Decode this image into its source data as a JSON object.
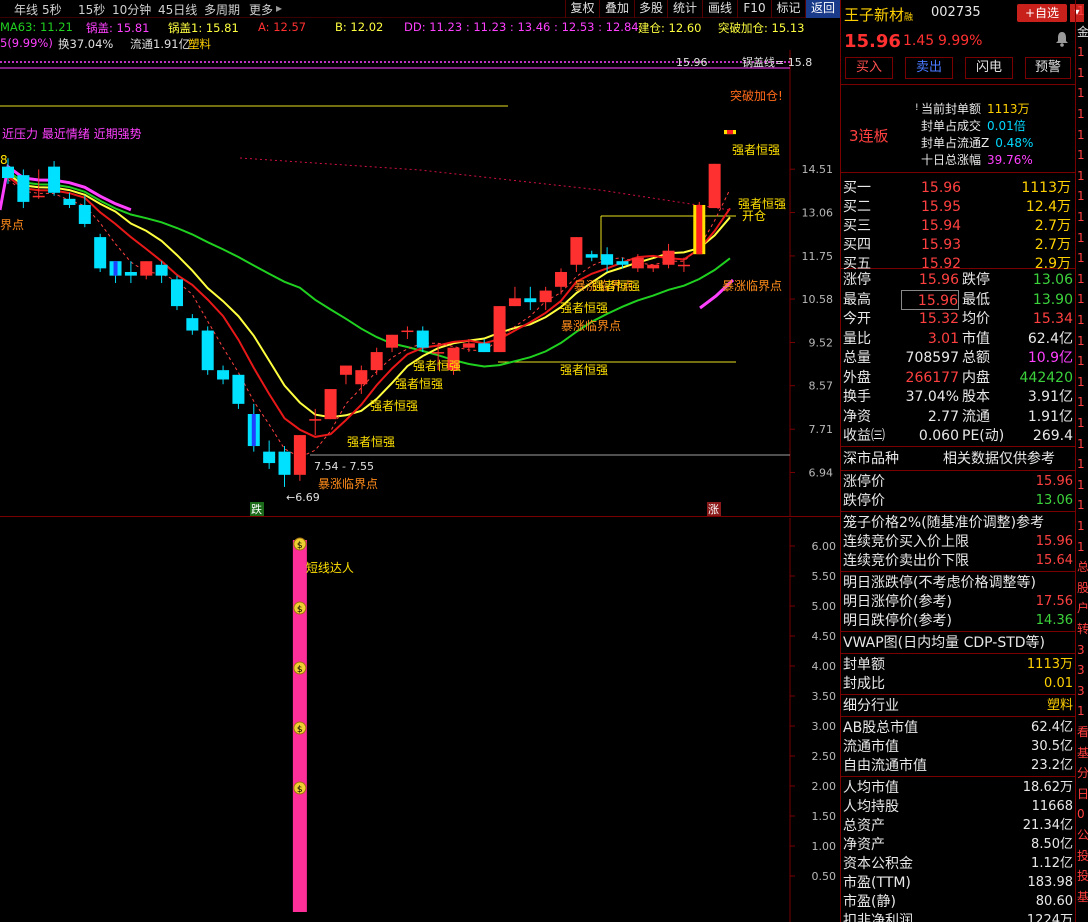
{
  "toolbar": {
    "items": [
      "年线",
      "5秒",
      "15秒",
      "10分钟",
      "45日线",
      "多周期",
      "更多"
    ],
    "more_arrow": "▸",
    "buttons": [
      "复权",
      "叠加",
      "多股",
      "统计",
      "画线",
      "F10",
      "标记",
      "返回"
    ]
  },
  "info1": {
    "ma63": "MA63: 11.21",
    "guogai": "锅盖: 15.81",
    "guogai1": "锅盖1: 15.81",
    "a": "A: 12.57",
    "b": "B: 12.02",
    "dd": "DD: 11.23 : 11.23 : 13.46 : 12.53 : 12.84",
    "jiancang": "建仓: 12.60",
    "tupo": "突破加仓: 15.13"
  },
  "info2": {
    "pct": "5(9.99%)",
    "turnover": "换37.04%",
    "float": "流通1.91亿",
    "industry": "塑料"
  },
  "chart_data": {
    "type": "candlestick",
    "price_axis": [
      "14.51",
      "13.06",
      "11.75",
      "10.58",
      "9.52",
      "8.57",
      "7.71",
      "6.94"
    ],
    "price_axis_values": [
      14.51,
      13.06,
      11.75,
      10.58,
      9.52,
      8.57,
      7.71,
      6.94
    ],
    "indicator_axis": [
      "6.00",
      "5.50",
      "5.00",
      "4.50",
      "4.00",
      "3.50",
      "3.00",
      "2.50",
      "2.00",
      "1.50",
      "1.00",
      "0.50"
    ],
    "indicator_axis_values": [
      6,
      5.5,
      5,
      4.5,
      4,
      3.5,
      3,
      2.5,
      2,
      1.5,
      1,
      0.5
    ],
    "candles": [
      [
        14.6,
        14.9,
        14.2,
        14.0
      ],
      [
        14.3,
        14.5,
        13.4,
        13.2
      ],
      [
        13.6,
        14.5,
        13.6,
        13.5
      ],
      [
        14.6,
        14.8,
        13.7,
        13.6
      ],
      [
        13.5,
        13.7,
        13.3,
        13.2
      ],
      [
        13.3,
        13.6,
        12.7,
        12.6
      ],
      [
        12.3,
        12.4,
        11.4,
        11.3
      ],
      [
        11.6,
        11.6,
        11.2,
        11.0
      ],
      [
        11.3,
        11.6,
        11.2,
        11.0
      ],
      [
        11.2,
        11.6,
        11.6,
        11.1
      ],
      [
        11.5,
        11.6,
        11.2,
        11.0
      ],
      [
        11.1,
        11.2,
        10.4,
        10.3
      ],
      [
        10.1,
        10.2,
        9.8,
        9.7
      ],
      [
        9.8,
        9.9,
        8.9,
        8.8
      ],
      [
        8.9,
        9.0,
        8.7,
        8.6
      ],
      [
        8.8,
        8.8,
        8.2,
        8.1
      ],
      [
        8.0,
        8.2,
        7.4,
        7.3
      ],
      [
        7.3,
        7.5,
        7.1,
        7.0
      ],
      [
        7.3,
        7.4,
        6.9,
        6.7
      ],
      [
        6.9,
        7.6,
        7.6,
        6.8
      ],
      [
        7.9,
        8.1,
        7.9,
        7.6
      ],
      [
        7.9,
        8.5,
        8.5,
        7.9
      ],
      [
        8.8,
        9.0,
        9.0,
        8.6
      ],
      [
        8.6,
        9.0,
        8.9,
        8.4
      ],
      [
        8.9,
        9.4,
        9.3,
        8.8
      ],
      [
        9.4,
        9.7,
        9.7,
        9.3
      ],
      [
        9.8,
        9.9,
        9.8,
        9.6
      ],
      [
        9.8,
        9.9,
        9.4,
        9.3
      ],
      [
        9.3,
        9.5,
        9.3,
        8.9
      ],
      [
        8.9,
        9.4,
        9.4,
        8.8
      ],
      [
        9.4,
        9.6,
        9.5,
        9.3
      ],
      [
        9.5,
        9.6,
        9.3,
        9.3
      ],
      [
        9.3,
        10.4,
        10.4,
        9.3
      ],
      [
        10.4,
        10.9,
        10.6,
        10.4
      ],
      [
        10.6,
        10.9,
        10.5,
        10.3
      ],
      [
        10.5,
        10.9,
        10.8,
        10.3
      ],
      [
        10.9,
        11.4,
        11.3,
        10.7
      ],
      [
        11.5,
        12.3,
        12.3,
        11.3
      ],
      [
        11.8,
        11.9,
        11.7,
        11.6
      ],
      [
        11.8,
        12.0,
        11.5,
        11.3
      ],
      [
        11.6,
        11.7,
        11.5,
        11.4
      ],
      [
        11.4,
        11.8,
        11.7,
        11.3
      ],
      [
        11.4,
        11.5,
        11.5,
        11.3
      ],
      [
        11.5,
        12.1,
        11.9,
        11.4
      ],
      [
        11.5,
        11.7,
        11.5,
        11.3
      ],
      [
        11.8,
        13.4,
        13.3,
        11.8
      ],
      [
        13.2,
        14.7,
        14.7,
        13.2
      ],
      [
        15.8,
        15.96,
        15.96,
        15.8
      ]
    ],
    "annotations": [
      {
        "text": "强者恒强",
        "type": "label"
      },
      {
        "text": "暴涨临界点",
        "type": "label"
      },
      {
        "text": "强者恒强",
        "type": "label"
      },
      {
        "text": "强者恒强",
        "type": "label"
      },
      {
        "text": "暴涨临界点",
        "type": "label"
      },
      {
        "text": "强者恒强",
        "type": "label"
      },
      {
        "text": "强者恒强",
        "type": "label"
      },
      {
        "text": "暴涨临界点",
        "type": "label"
      },
      {
        "text": "强者恒强",
        "type": "label"
      },
      {
        "text": "开仓",
        "type": "label"
      },
      {
        "text": "突破加仓!",
        "type": "label"
      },
      {
        "text": "强者恒强",
        "type": "label"
      },
      {
        "text": "强者恒强",
        "type": "label"
      },
      {
        "text": "强者恒强",
        "type": "label"
      }
    ],
    "top_left_text": "近压力 最近情绪 近期强势",
    "left_label": "界点",
    "left_label2": "8",
    "low_label": "6.69",
    "range_label": "7.54 - 7.55",
    "high_label": "15.96",
    "guogai_label": "锅盖线= 15.8",
    "die_badge": "跌",
    "zhang_badge": "涨",
    "indicator_label": "短线达人",
    "indicator_icon": "money-bag-icon",
    "indicator_icon_glyph": "$",
    "bar_value": 6.0,
    "colors": {
      "up": "#ff3030",
      "down": "#00e0ff",
      "ma_yellow": "#ffff40",
      "ma_red": "#ff2020",
      "ma_green": "#20d020",
      "ma_magenta": "#ff40ff",
      "limit_up": "#ffe000"
    }
  },
  "stock": {
    "name": "王子新材",
    "tag": "融",
    "code": "002735",
    "add_btn": "+自选",
    "price": "15.96",
    "change": "1.45",
    "change_pct": "9.99%",
    "bell_icon": "bell-icon"
  },
  "trade_buttons": [
    "买入",
    "卖出",
    "闪电",
    "预警"
  ],
  "lianban": {
    "label": "3连板",
    "rows": [
      {
        "k": "当前封单额",
        "v": "1113万",
        "icon": "!"
      },
      {
        "k": "封单占成交",
        "v": "0.01倍"
      },
      {
        "k": "封单占流通Z",
        "v": "0.48%"
      },
      {
        "k": "十日总涨幅",
        "v": "39.76%"
      }
    ]
  },
  "bids": [
    {
      "k": "买一",
      "p": "15.96",
      "v": "1113万"
    },
    {
      "k": "买二",
      "p": "15.95",
      "v": "12.4万"
    },
    {
      "k": "买三",
      "p": "15.94",
      "v": "2.7万"
    },
    {
      "k": "买四",
      "p": "15.93",
      "v": "2.7万"
    },
    {
      "k": "买五",
      "p": "15.92",
      "v": "2.9万"
    }
  ],
  "stats": [
    {
      "k1": "涨停",
      "v1": "15.96",
      "c1": "red",
      "k2": "跌停",
      "v2": "13.06",
      "c2": "green"
    },
    {
      "k1": "最高",
      "v1": "15.96",
      "c1": "red",
      "k2": "最低",
      "v2": "13.90",
      "c2": "green"
    },
    {
      "k1": "今开",
      "v1": "15.32",
      "c1": "red",
      "k2": "均价",
      "v2": "15.34",
      "c2": "red"
    },
    {
      "k1": "量比",
      "v1": "3.01",
      "c1": "red",
      "k2": "市值",
      "v2": "62.4亿",
      "c2": "white"
    },
    {
      "k1": "总量",
      "v1": "708597",
      "c1": "white",
      "k2": "总额",
      "v2": "10.9亿",
      "c2": "magenta"
    },
    {
      "k1": "外盘",
      "v1": "266177",
      "c1": "red",
      "k2": "内盘",
      "v2": "442420",
      "c2": "green"
    },
    {
      "k1": "换手",
      "v1": "37.04%",
      "c1": "white",
      "k2": "股本",
      "v2": "3.91亿",
      "c2": "white"
    },
    {
      "k1": "净资",
      "v1": "2.77",
      "c1": "white",
      "k2": "流通",
      "v2": "1.91亿",
      "c2": "white"
    },
    {
      "k1": "收益㈢",
      "v1": "0.060",
      "c1": "white",
      "k2": "PE(动)",
      "v2": "269.4",
      "c2": "white"
    }
  ],
  "market": {
    "left": "深市品种",
    "right": "相关数据仅供参考"
  },
  "limits": [
    {
      "k": "涨停价",
      "v": "15.96",
      "c": "red"
    },
    {
      "k": "跌停价",
      "v": "13.06",
      "c": "green"
    }
  ],
  "cage_title": "笼子价格2%(随基准价调整)参考",
  "auction": [
    {
      "k": "连续竞价买入价上限",
      "v": "15.96",
      "c": "red"
    },
    {
      "k": "连续竞价卖出价下限",
      "v": "15.64",
      "c": "red"
    }
  ],
  "tomorrow_title": "明日涨跌停(不考虑价格调整等)",
  "tomorrow": [
    {
      "k": "明日涨停价(参考)",
      "v": "17.56",
      "c": "red"
    },
    {
      "k": "明日跌停价(参考)",
      "v": "14.36",
      "c": "green"
    }
  ],
  "vwap_title": "VWAP图(日内均量 CDP-STD等)",
  "bottom_rows": [
    {
      "k": "封单额",
      "v": "1113万",
      "c": "yellow"
    },
    {
      "k": "封成比",
      "v": "0.01",
      "c": "yellow"
    },
    {
      "k": "细分行业",
      "v": "塑料",
      "c": "yellow"
    },
    {
      "k": "AB股总市值",
      "v": "62.4亿",
      "c": "white"
    },
    {
      "k": "流通市值",
      "v": "30.5亿",
      "c": "white"
    },
    {
      "k": "自由流通市值",
      "v": "23.2亿",
      "c": "white"
    },
    {
      "k": "人均市值",
      "v": "18.62万",
      "c": "white"
    },
    {
      "k": "人均持股",
      "v": "11668",
      "c": "white"
    },
    {
      "k": "总资产",
      "v": "21.34亿",
      "c": "white"
    },
    {
      "k": "净资产",
      "v": "8.50亿",
      "c": "white"
    },
    {
      "k": "资本公积金",
      "v": "1.12亿",
      "c": "white"
    },
    {
      "k": "市盈(TTM)",
      "v": "183.98",
      "c": "white"
    },
    {
      "k": "市盈(静)",
      "v": "80.60",
      "c": "white"
    },
    {
      "k": "扣非净利润",
      "v": "1224万",
      "c": "white"
    }
  ],
  "strip": [
    "1",
    "金",
    "1",
    "1",
    "1",
    "1",
    "1",
    "1",
    "1",
    "1",
    "1",
    "1",
    "1",
    "1",
    "1",
    "1",
    "1",
    "1",
    "1",
    "1",
    "1",
    "1",
    "1",
    "1",
    "1",
    "1",
    "1",
    "总",
    "股",
    "户",
    "转",
    "3",
    "3",
    "3",
    "1",
    "看",
    "基",
    "分",
    "日",
    "0",
    "公",
    "投",
    "投",
    "基"
  ]
}
